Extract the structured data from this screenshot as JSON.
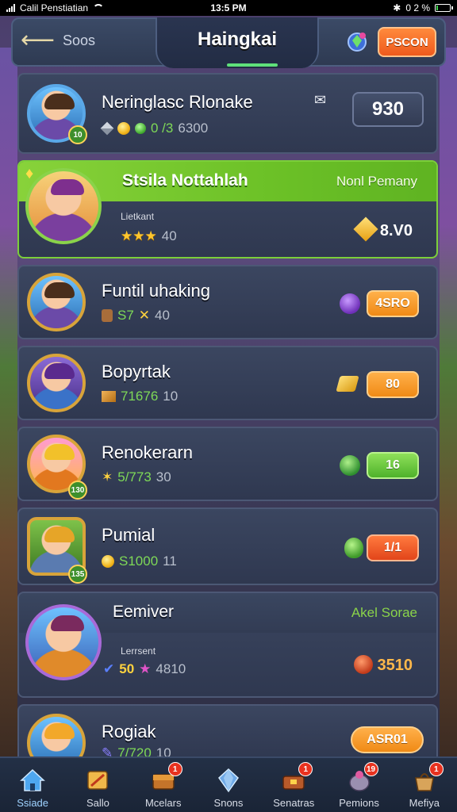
{
  "status_bar": {
    "carrier": "Calil Penstiatian",
    "time": "13:5 PM",
    "battery": "0 2 %"
  },
  "header": {
    "back_label": "Soos",
    "title": "Haingkai",
    "action_label": "PSCON"
  },
  "rows": [
    {
      "name": "Neringlasc Rlonake",
      "badge": "10",
      "stats": [
        "0 /3",
        "6300"
      ],
      "score": "930"
    },
    {
      "banner_title": "Stsila Nottahlah",
      "banner_right": "Nonl Pemany",
      "sub_label": "Lietkant",
      "stars": "★★★",
      "level": "40",
      "value": "8.V0"
    },
    {
      "name": "Funtil uhaking",
      "stats": [
        "S7",
        "40"
      ],
      "pill": "4SRO"
    },
    {
      "name": "Bopyrtak",
      "stats": [
        "71676",
        "10"
      ],
      "pill": "80"
    },
    {
      "name": "Renokerarn",
      "badge": "130",
      "stats": [
        "5/773",
        "30"
      ],
      "pill": "16"
    },
    {
      "name": "Pumial",
      "badge": "135",
      "stats": [
        "S1000",
        "11"
      ],
      "pill": "1/1"
    },
    {
      "banner_title": "Eemiver",
      "banner_right": "Akel Sorae",
      "sub_label": "Lerrsent",
      "stats": [
        "50",
        "4810"
      ],
      "value": "3510"
    },
    {
      "name": "Rogiak",
      "stats": [
        "7/720",
        "10"
      ],
      "pill": "ASR01"
    }
  ],
  "nav": [
    {
      "label": "Ssiade",
      "badge": ""
    },
    {
      "label": "Sallo",
      "badge": ""
    },
    {
      "label": "Mcelars",
      "badge": "1"
    },
    {
      "label": "Snons",
      "badge": ""
    },
    {
      "label": "Senatras",
      "badge": "1"
    },
    {
      "label": "Pemions",
      "badge": "19"
    },
    {
      "label": "Mefiya",
      "badge": "1"
    }
  ],
  "colors": {
    "accent_green": "#6cc127",
    "accent_orange": "#f08a15",
    "panel": "#2f3850"
  }
}
